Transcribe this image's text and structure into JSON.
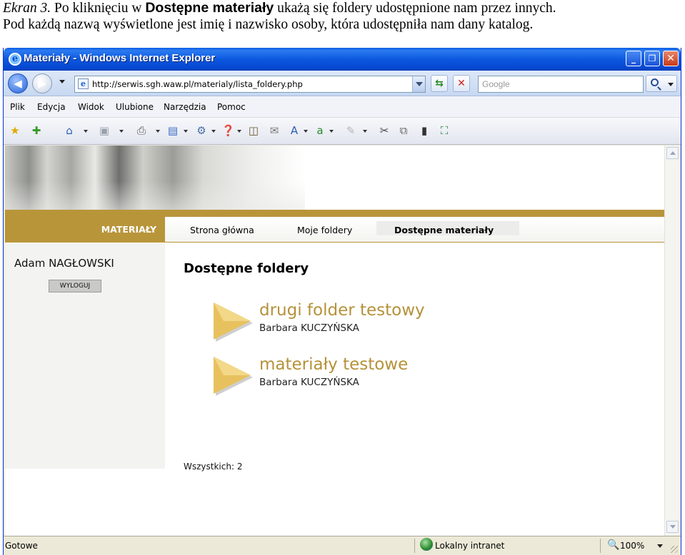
{
  "caption": {
    "label": "Ekran 3.",
    "part1": " Po kliknięciu w ",
    "bold": "Dostępne materiały",
    "part2": " ukażą się foldery udostępnione nam przez innych.",
    "line2": "Pod każdą nazwą wyświetlone jest imię i nazwisko osoby, która udostępniła nam dany katalog."
  },
  "window": {
    "title": "Materiały - Windows Internet Explorer",
    "controls": [
      "minimize",
      "maximize",
      "close"
    ]
  },
  "addressbar": {
    "url": "http://serwis.sgh.waw.pl/materialy/lista_foldery.php",
    "search_placeholder": "Google"
  },
  "menubar": {
    "items": [
      "Plik",
      "Edycja",
      "Widok",
      "Ulubione",
      "Narzędzia",
      "Pomoc"
    ]
  },
  "toolbar_icons": [
    "favorites-star-icon",
    "add-favorites-icon",
    "home-icon",
    "feeds-icon",
    "print-icon",
    "page-icon",
    "tools-gear-icon",
    "help-icon",
    "research-icon",
    "mail-icon",
    "spelling-icon",
    "translate-icon",
    "pencil-icon",
    "cut-icon",
    "copy-icon",
    "paste-icon",
    "fullscreen-icon"
  ],
  "site": {
    "section": "MATERIAŁY",
    "nav": [
      "Strona główna",
      "Moje foldery",
      "Dostępne materiały"
    ],
    "active_nav": "Dostępne materiały",
    "user": "Adam NAGŁOWSKI",
    "logout": "WYLOGUJ",
    "heading": "Dostępne foldery",
    "folders": [
      {
        "name": "drugi folder testowy",
        "owner": "Barbara KUCZYŃSKA"
      },
      {
        "name": "materiały testowe",
        "owner": "Barbara KUCZYŃSKA"
      }
    ],
    "total": "Wszystkich: 2",
    "accent_color": "#b9953a"
  },
  "statusbar": {
    "status": "Gotowe",
    "zone": "Lokalny intranet",
    "zoom": "100%"
  }
}
